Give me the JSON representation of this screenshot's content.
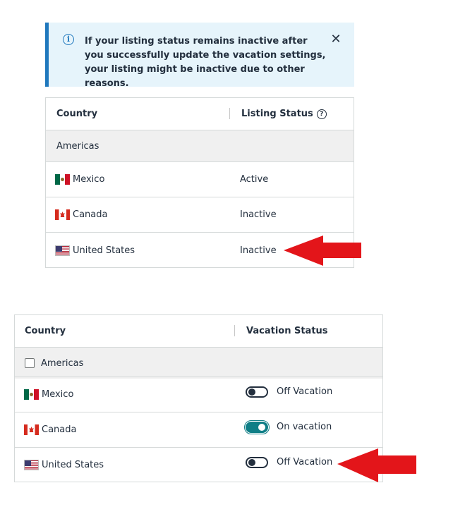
{
  "alert": {
    "message": "If your listing status remains inactive after you successfully update the vacation settings, your listing might be inactive due to other reasons.",
    "icon": "info-icon",
    "close_icon": "close-icon"
  },
  "listing_table": {
    "col_country": "Country",
    "col_status": "Listing Status",
    "help_icon": "question-circle-icon",
    "group": "Americas",
    "rows": [
      {
        "country": "Mexico",
        "flag": "mexico-flag-icon",
        "status": "Active"
      },
      {
        "country": "Canada",
        "flag": "canada-flag-icon",
        "status": "Inactive"
      },
      {
        "country": "United States",
        "flag": "us-flag-icon",
        "status": "Inactive"
      }
    ]
  },
  "vacation_table": {
    "col_country": "Country",
    "col_status": "Vacation Status",
    "group": "Americas",
    "rows": [
      {
        "country": "Mexico",
        "flag": "mexico-flag-icon",
        "toggle_on": false,
        "status": "Off Vacation"
      },
      {
        "country": "Canada",
        "flag": "canada-flag-icon",
        "toggle_on": true,
        "status": "On vacation"
      },
      {
        "country": "United States",
        "flag": "us-flag-icon",
        "toggle_on": false,
        "status": "Off Vacation"
      }
    ]
  },
  "colors": {
    "accent": "#1f78bd",
    "active": "#5b8b2c",
    "inactive": "#f0951e",
    "toggle_on": "#0f7e86",
    "arrow": "#e3151a"
  }
}
